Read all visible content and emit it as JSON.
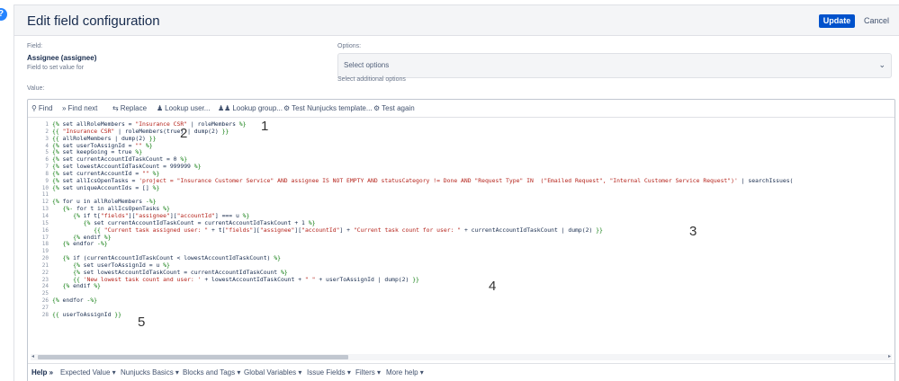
{
  "header": {
    "title": "Edit field configuration",
    "update_label": "Update",
    "cancel_label": "Cancel"
  },
  "help_bubble": "?",
  "field": {
    "label": "Field:",
    "value": "Assignee (assignee)",
    "hint": "Field to set value for"
  },
  "options": {
    "label": "Options:",
    "placeholder": "Select options",
    "hint": "Select additional options"
  },
  "value_label": "Value:",
  "toolbar": [
    {
      "icon": "search-icon",
      "glyph": "⚲",
      "label": "Find"
    },
    {
      "icon": "find-next-icon",
      "glyph": "»",
      "label": "Find next"
    },
    {
      "icon": "replace-icon",
      "glyph": "⇆",
      "label": "Replace"
    },
    {
      "icon": "user-icon",
      "glyph": "♟",
      "label": "Lookup user..."
    },
    {
      "icon": "group-icon",
      "glyph": "♟♟",
      "label": "Lookup group..."
    },
    {
      "icon": "test-icon",
      "glyph": "⚙",
      "label": "Test Nunjucks template..."
    },
    {
      "icon": "test-again-icon",
      "glyph": "⚙",
      "label": "Test again"
    }
  ],
  "code_lines": [
    "{% set allRoleMembers = \"Insurance CSR\" | roleMembers %}",
    "{{ \"Insurance CSR\" | roleMembers(true) | dump(2) }}",
    "{{ allRoleMembers | dump(2) }}",
    "{% set userToAssignId = \"\" %}",
    "{% set keepGoing = true %}",
    "{% set currentAccountIdTaskCount = 0 %}",
    "{% set lowestAccountIdTaskCount = 999999 %}",
    "{% set currentAccountId = \"\" %}",
    "{% set allIcsOpenTasks = 'project = \"Insurance Customer Service\" AND assignee IS NOT EMPTY AND statusCategory != Done AND \"Request Type\" IN  (\"Emailed Request\", \"Internal Customer Service Request\")' | searchIssues(",
    "{% set uniqueAccountIds = [] %}",
    "",
    "{% for u in allRoleMembers -%}",
    "   {%- for t in allIcsOpenTasks %}",
    "      {% if t[\"fields\"][\"assignee\"][\"accountId\"] === u %}",
    "         {% set currentAccountIdTaskCount = currentAccountIdTaskCount + 1 %}",
    "            {{ \"Current task assigned user: \" + t[\"fields\"][\"assignee\"][\"accountId\"] + \"Current task count for user: \" + currentAccountIdTaskCount | dump(2) }}",
    "      {% endif %}",
    "   {% endfor -%}",
    "",
    "   {% if (currentAccountIdTaskCount < lowestAccountIdTaskCount) %}",
    "      {% set userToAssignId = u %}",
    "      {% set lowestAccountIdTaskCount = currentAccountIdTaskCount %}",
    "      {{ 'New lowest task count and user: ' + lowestAccountIdTaskCount + \" \" + userToAssignId | dump(2) }}",
    "   {% endif %}",
    "",
    "{% endfor -%}",
    "",
    "{{ userToAssignId }}"
  ],
  "line_numbers": [
    "1",
    "2",
    "3",
    "4",
    "5",
    "6",
    "7",
    "8",
    "9",
    "10",
    "11",
    "12",
    "13",
    "14",
    "15",
    "16",
    "17",
    "18",
    "19",
    "20",
    "21",
    "22",
    "23",
    "24",
    "25",
    "26",
    "27",
    "28"
  ],
  "annotations": [
    "1",
    "2",
    "3",
    "4",
    "5"
  ],
  "scroll": {
    "left": "◂",
    "right": "▸"
  },
  "helpbar": {
    "help": "Help",
    "arrow": "»",
    "items": [
      "Expected Value ▾",
      "Nunjucks Basics ▾",
      "Blocks and Tags ▾",
      "Global Variables ▾",
      "Issue Fields ▾",
      "Filters ▾",
      "More help ▾"
    ]
  },
  "colors": {
    "keyword": "#0b7a0b",
    "string": "#b5241c",
    "number": "#0b7a0b",
    "primary": "#0052cc"
  }
}
